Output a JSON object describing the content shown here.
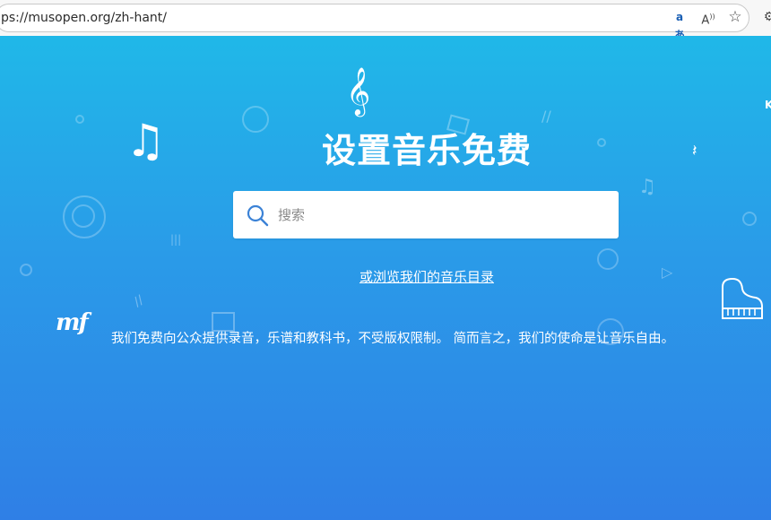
{
  "browser": {
    "url": "ps://musopen.org/zh-hant/",
    "icons": [
      "translate-icon",
      "read-aloud-icon",
      "favorite-star-icon",
      "extensions-icon"
    ],
    "translate_glyph": "aあ",
    "read_aloud_glyph": "A⁾",
    "favorite_glyph": "☆",
    "extension_glyph": "⚙"
  },
  "hero": {
    "title": "设置音乐免费",
    "search_placeholder": "搜索",
    "browse_link": "或浏览我们的音乐目录",
    "logo_text": "mf",
    "mission": "我们免费向公众提供录音，乐谱和教科书，不受版权限制。 简而言之，我们的使命是让音乐自由。",
    "treble_glyph": "𝄞",
    "notes_glyph": "♫",
    "edge_letter": "K"
  },
  "colors": {
    "gradient_top": "#20b8e8",
    "gradient_bottom": "#2f7fe6",
    "text": "#ffffff"
  }
}
